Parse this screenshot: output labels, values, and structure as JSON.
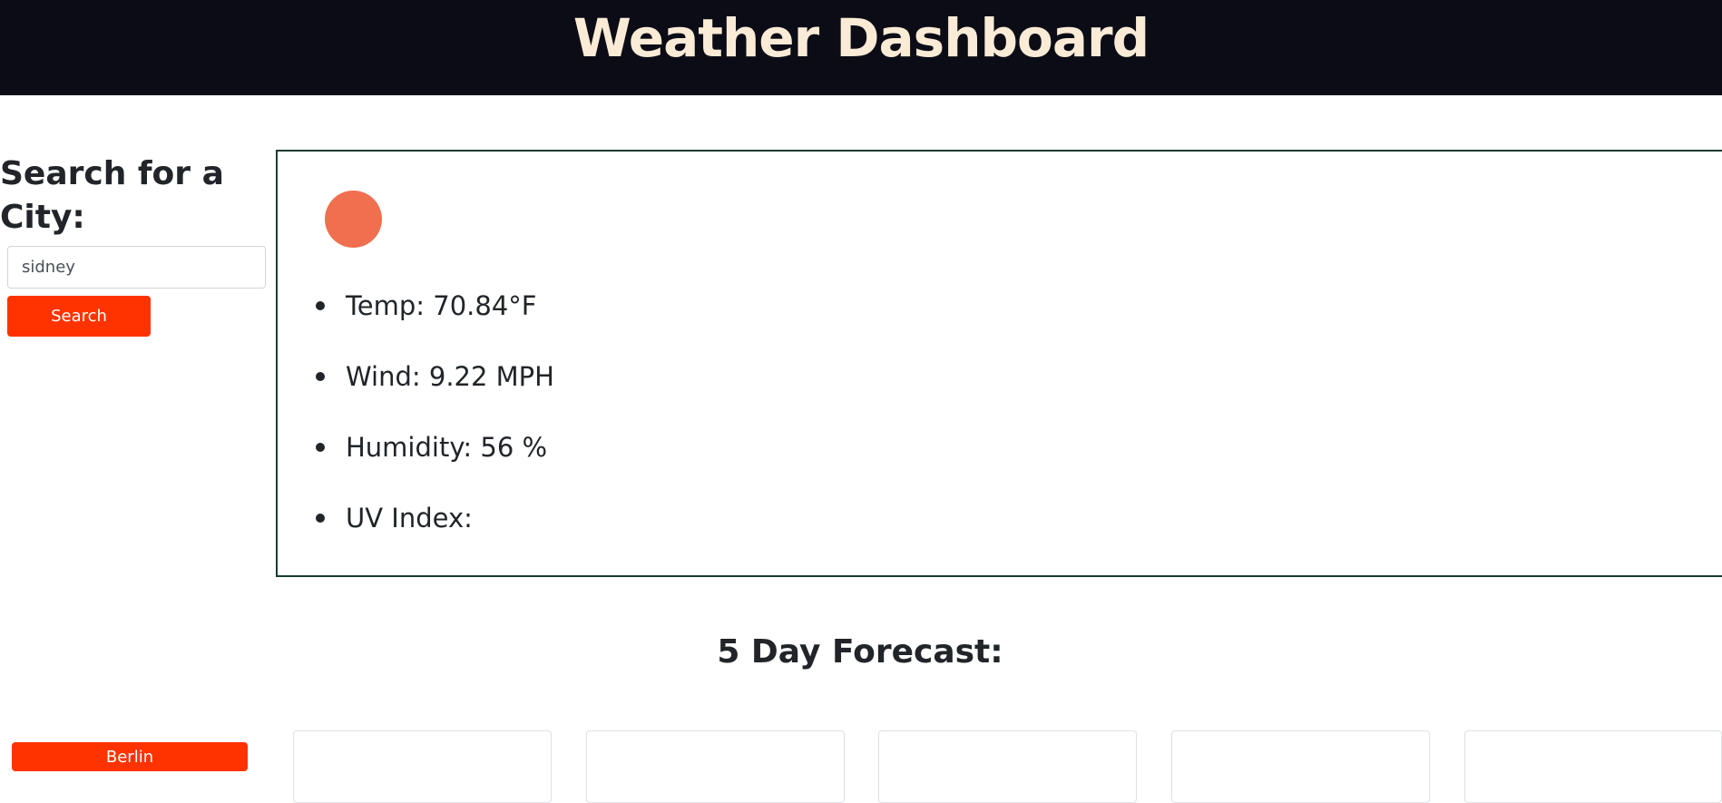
{
  "header": {
    "title": "Weather Dashboard"
  },
  "search": {
    "title": "Search for a City:",
    "input_value": "sidney",
    "button_label": "Search"
  },
  "history": {
    "items": [
      "Berlin"
    ]
  },
  "current": {
    "icon": "weather-condition-icon",
    "stats": [
      "Temp: 70.84°F",
      "Wind: 9.22 MPH",
      "Humidity: 56 %",
      "UV Index:"
    ]
  },
  "forecast": {
    "title": "5 Day Forecast:"
  },
  "colors": {
    "header_bg": "#0c0c16",
    "header_text": "#faebd7",
    "accent": "#ff3300",
    "weather_icon": "#ef6f4f",
    "box_border": "#1b3a34"
  }
}
